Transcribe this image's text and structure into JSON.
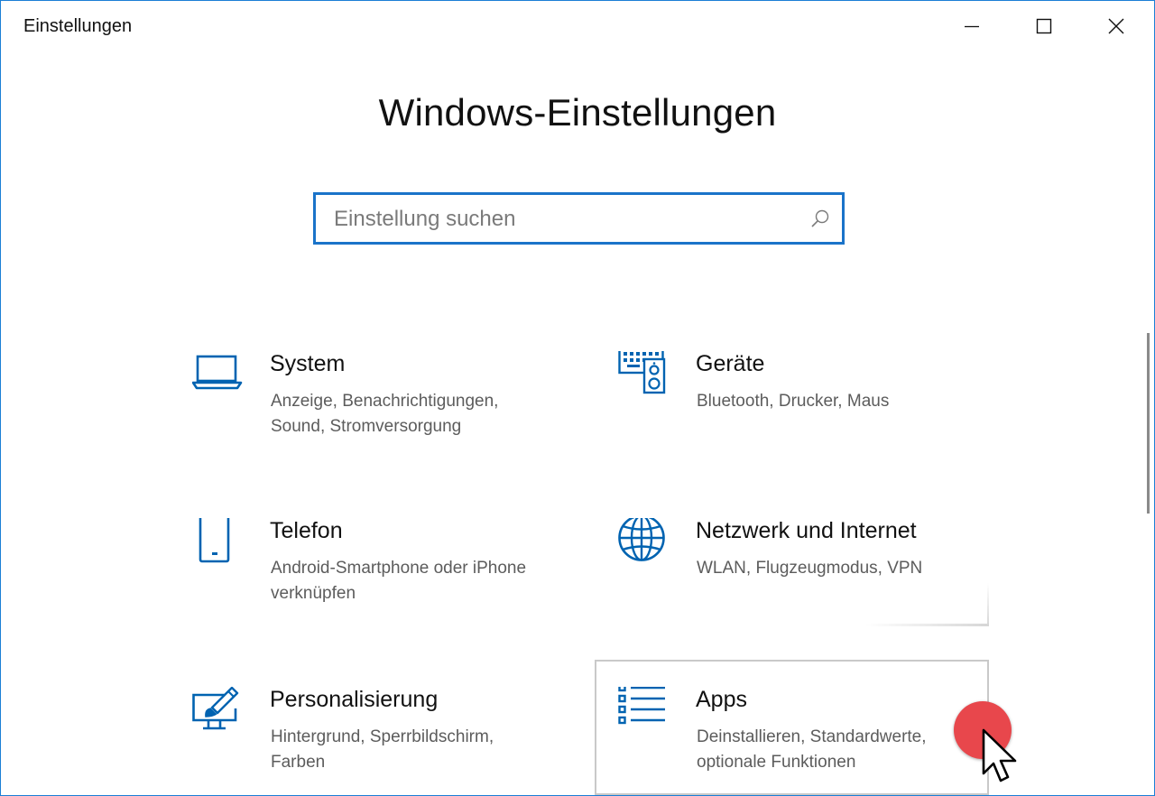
{
  "window": {
    "title": "Einstellungen",
    "controls": [
      "minimize-icon",
      "maximize-icon",
      "close-icon"
    ]
  },
  "page": {
    "title": "Windows-Einstellungen"
  },
  "search": {
    "placeholder": "Einstellung suchen",
    "value": "",
    "icon": "search-icon"
  },
  "tiles": [
    {
      "name": "System",
      "description": "Anzeige, Benachrichtigungen, Sound, Stromversorgung",
      "icon": "laptop-icon"
    },
    {
      "name": "Geräte",
      "description": "Bluetooth, Drucker, Maus",
      "icon": "devices-icon"
    },
    {
      "name": "Telefon",
      "description": "Android-Smartphone oder iPhone verknüpfen",
      "icon": "phone-icon"
    },
    {
      "name": "Netzwerk und Internet",
      "description": "WLAN, Flugzeugmodus, VPN",
      "icon": "globe-icon"
    },
    {
      "name": "Personalisierung",
      "description": "Hintergrund, Sperrbildschirm, Farben",
      "icon": "personalization-icon"
    },
    {
      "name": "Apps",
      "description": "Deinstallieren, Standardwerte, optionale Funktionen",
      "icon": "apps-list-icon"
    }
  ],
  "colors": {
    "accent": "#0063b1",
    "window_border": "#1b7fd6",
    "search_border": "#1a73c9",
    "click_indicator": "#e8474c"
  }
}
